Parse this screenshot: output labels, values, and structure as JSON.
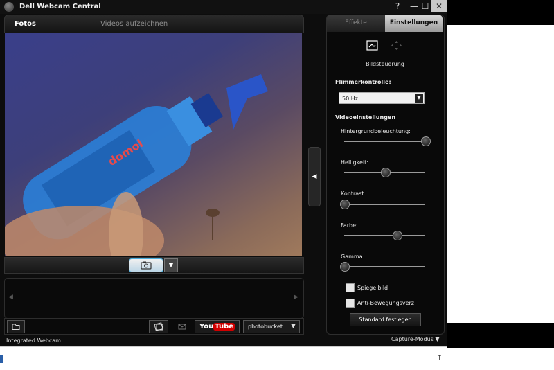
{
  "window": {
    "title": "Dell Webcam Central",
    "controls": {
      "help": "?",
      "minimize": "—",
      "maximize": "☐",
      "close": "✕"
    }
  },
  "left_tabs": [
    {
      "label": "Fotos aufnehmen",
      "active": true
    },
    {
      "label": "Videos aufzeichnen",
      "active": false
    }
  ],
  "video": {
    "bottle_label": "domol"
  },
  "capture": {
    "icon": "camera-icon",
    "dropdown": "▼"
  },
  "thumbnails": {
    "prev": "◀",
    "next": "▶"
  },
  "bottom_toolbar": {
    "youtube_you": "You",
    "youtube_tube": "Tube",
    "photobucket": "photobucket",
    "dropdown": "▼"
  },
  "side_toggle": "◀",
  "right_panel": {
    "tabs": [
      {
        "label": "Effekte",
        "active": false
      },
      {
        "label": "Einstellungen",
        "active": true
      }
    ],
    "section_label": "Bildsteuerung",
    "flicker": {
      "label": "Flimmerkontrolle:",
      "value": "50 Hz",
      "arrow": "▼"
    },
    "video_settings_label": "Videoeinstellungen",
    "sliders": [
      {
        "label": "Hintergrundbeleuchtung:",
        "value": 1.0
      },
      {
        "label": "Helligkeit:",
        "value": 0.5
      },
      {
        "label": "Kontrast:",
        "value": 0.0
      },
      {
        "label": "Farbe:",
        "value": 0.65
      },
      {
        "label": "Gamma:",
        "value": 0.0
      }
    ],
    "checkboxes": [
      {
        "label": "Spiegelbild",
        "checked": false
      },
      {
        "label": "Anti-Bewegungsverz",
        "checked": false
      }
    ],
    "reset_button": "Standard festlegen"
  },
  "status": {
    "device": "Integrated Webcam",
    "mode": "Capture-Modus ▼"
  },
  "taskbar_fragment": "T",
  "colors": {
    "accent": "#3aa0d0",
    "capture_border": "#4cb0e0",
    "youtube_red": "#d10000"
  }
}
